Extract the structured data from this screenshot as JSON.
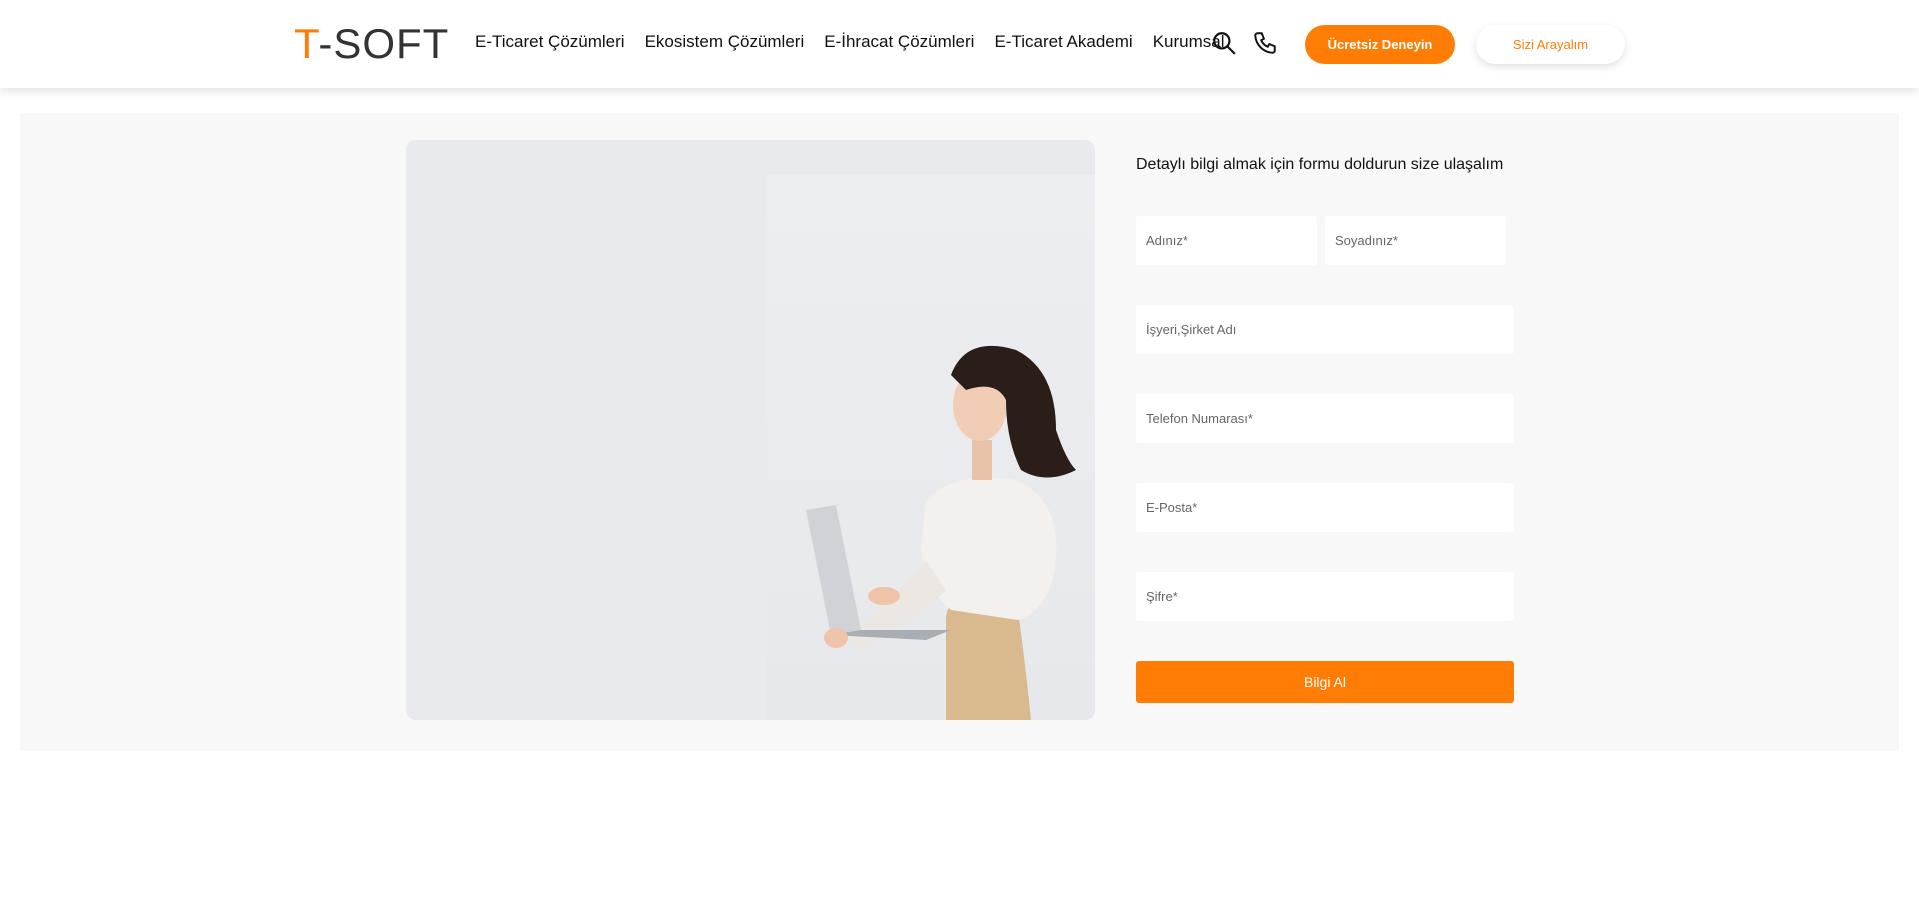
{
  "header": {
    "logo": {
      "t": "T",
      "dash": "-",
      "soft": "SOFT"
    },
    "nav": [
      {
        "label": "E-Ticaret Çözümleri"
      },
      {
        "label": "Ekosistem Çözümleri"
      },
      {
        "label": "E-İhracat Çözümleri"
      },
      {
        "label": "E-Ticaret Akademi"
      },
      {
        "label": "Kurumsal"
      }
    ],
    "icons": {
      "search": "search-icon",
      "phone": "phone-icon"
    },
    "cta_primary": "Ücretsiz Deneyin",
    "cta_secondary": "Sizi Arayalım"
  },
  "form": {
    "title": "Detaylı bilgi almak için formu doldurun size ulaşalım",
    "first_name": "Adınız*",
    "last_name": "Soyadınız*",
    "company": "İşyeri,Şirket Adı",
    "phone": "Telefon Numarası*",
    "email": "E-Posta*",
    "password": "Şifre*",
    "submit": "Bilgi Al"
  },
  "colors": {
    "accent": "#ff7d05",
    "section_bg": "#f8f8f8"
  }
}
